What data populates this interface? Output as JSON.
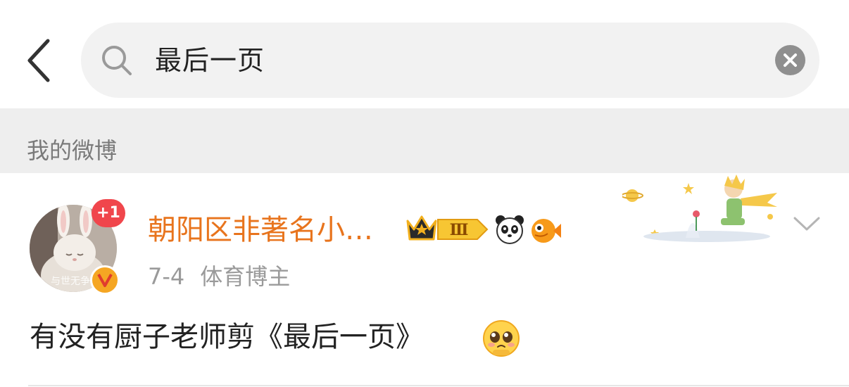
{
  "search": {
    "query": "最后一页"
  },
  "section": {
    "label": "我的微博"
  },
  "post": {
    "avatar_badge": "+1",
    "avatar_caption": "与世无争",
    "username": "朝阳区非著名小…",
    "level": "Ⅲ",
    "date": "7-4",
    "tag": "体育博主",
    "text": "有没有厨子老师剪《最后一页》",
    "emoji": "pleading-face-icon"
  },
  "icons": {
    "back": "back-chevron-icon",
    "search": "search-icon",
    "clear": "clear-icon",
    "verified": "verified-v-icon",
    "crown": "crown-icon",
    "panda": "panda-icon",
    "fish": "fish-icon",
    "more": "chevron-down-icon"
  },
  "colors": {
    "username": "#e8741d",
    "badge": "#f0464c",
    "verified": "#f5a623",
    "search_bg": "#f2f2f2",
    "section_bg": "#eeeeee"
  }
}
